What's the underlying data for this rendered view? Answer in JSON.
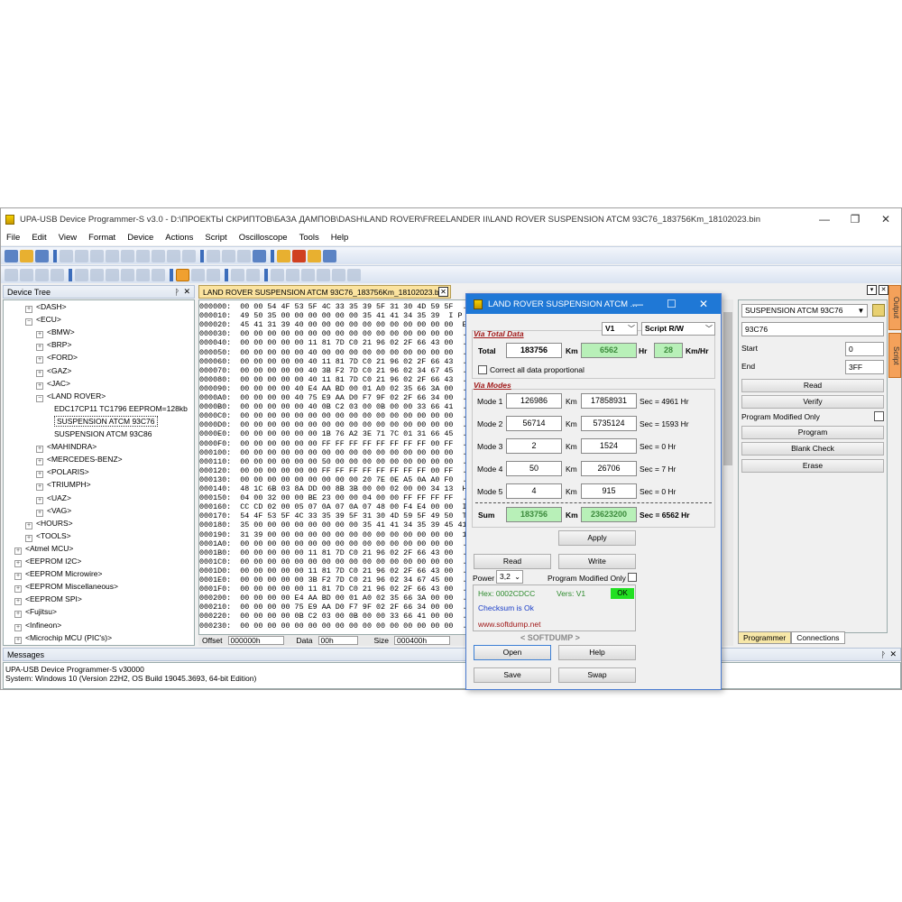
{
  "window": {
    "title": "UPA-USB Device Programmer-S v3.0 - D:\\ПРОЕКТЫ СКРИПТОВ\\БАЗА ДАМПОВ\\DASH\\LAND ROVER\\FREELANDER II\\LAND ROVER SUSPENSION ATCM 93C76_183756Km_18102023.bin",
    "minimize": "—",
    "maximize": "❐",
    "close": "✕"
  },
  "menu": [
    "File",
    "Edit",
    "View",
    "Format",
    "Device",
    "Actions",
    "Script",
    "Oscilloscope",
    "Tools",
    "Help"
  ],
  "device_tree": {
    "title": "Device Tree",
    "pin": "ᚹ",
    "close": "✕",
    "nodes": [
      {
        "label": "<DASH>",
        "pm": "+"
      },
      {
        "label": "<ECU>",
        "pm": "−"
      },
      {
        "label": "<BMW>",
        "pm": "+"
      },
      {
        "label": "<BRP>",
        "pm": "+"
      },
      {
        "label": "<FORD>",
        "pm": "+"
      },
      {
        "label": "<GAZ>",
        "pm": "+"
      },
      {
        "label": "<JAC>",
        "pm": "+"
      },
      {
        "label": "<LAND ROVER>",
        "pm": "−"
      },
      {
        "label": "EDC17CP11 TC1796 EEPROM=128kb",
        "pm": ""
      },
      {
        "label": "SUSPENSION ATCM 93C76",
        "pm": ""
      },
      {
        "label": "SUSPENSION ATCM 93C86",
        "pm": ""
      },
      {
        "label": "<MAHINDRA>",
        "pm": "+"
      },
      {
        "label": "<MERCEDES-BENZ>",
        "pm": "+"
      },
      {
        "label": "<POLARIS>",
        "pm": "+"
      },
      {
        "label": "<TRIUMPH>",
        "pm": "+"
      },
      {
        "label": "<UAZ>",
        "pm": "+"
      },
      {
        "label": "<VAG>",
        "pm": "+"
      },
      {
        "label": "<HOURS>",
        "pm": "+"
      },
      {
        "label": "<TOOLS>",
        "pm": "+"
      },
      {
        "label": "<Atmel MCU>",
        "pm": "+"
      },
      {
        "label": "<EEPROM I2C>",
        "pm": "+"
      },
      {
        "label": "<EEPROM Microwire>",
        "pm": "+"
      },
      {
        "label": "<EEPROM Miscellaneous>",
        "pm": "+"
      },
      {
        "label": "<EEPROM SPI>",
        "pm": "+"
      },
      {
        "label": "<Fujitsu>",
        "pm": "+"
      },
      {
        "label": "<Infineon>",
        "pm": "+"
      },
      {
        "label": "<Microchip MCU (PIC's)>",
        "pm": "+"
      }
    ]
  },
  "doc_tab": {
    "label": "LAND ROVER SUSPENSION ATCM 93C76_183756Km_18102023.bin",
    "close": "✕"
  },
  "hex_rows": [
    "000000:  00 00 54 4F 53 5F 4C 33 35 39 5F 31 30 4D 59 5F  . . T O",
    "000010:  49 50 35 00 00 00 00 00 00 35 41 41 34 35 39  I P 5 .",
    "000020:  45 41 31 39 40 00 00 00 00 00 00 00 00 00 00 00  E A 1 9",
    "000030:  00 00 00 00 00 00 00 00 00 00 00 00 00 00 00 00  . . . .",
    "000040:  00 00 00 00 00 11 81 7D C0 21 96 02 2F 66 43 00  . . . .",
    "000050:  00 00 00 00 00 40 00 00 00 00 00 00 00 00 00 00  . . . .",
    "000060:  00 00 00 00 00 40 11 81 7D C0 21 96 02 2F 66 43  . . . .",
    "000070:  00 00 00 00 00 40 3B F2 7D C0 21 96 02 34 67 45  . . . .",
    "000080:  00 00 00 00 00 40 11 81 7D C0 21 96 02 2F 66 43  . . . .",
    "000090:  00 00 00 00 40 E4 AA BD 00 01 A0 02 35 66 3A 00  . . . .",
    "0000A0:  00 00 00 00 40 75 E9 AA D0 F7 9F 02 2F 66 34 00  . . . .",
    "0000B0:  00 00 00 00 00 40 0B C2 03 00 0B 00 00 33 66 41  . . . .",
    "0000C0:  00 00 00 00 00 00 00 00 00 00 00 00 00 00 00 00  . . . .",
    "0000D0:  00 00 00 00 00 00 00 00 00 00 00 00 00 00 00 00  . . . .",
    "0000E0:  00 00 00 00 00 00 1B 76 A2 3E 71 7C 01 31 66 45  . . . .",
    "0000F0:  00 00 00 00 00 00 FF FF FF FF FF FF FF FF 00 FF  . . . .",
    "000100:  00 00 00 00 00 00 00 00 00 00 00 00 00 00 00 00  . . . .",
    "000110:  00 00 00 00 00 00 50 00 00 00 00 00 00 00 00 00  . . . .",
    "000120:  00 00 00 00 00 00 FF FF FF FF FF FF FF FF 00 FF  . . . .",
    "000130:  00 00 00 00 00 00 00 00 00 20 7E 0E A5 0A A0 F0  . . . .",
    "000140:  48 1C 6B 03 8A DD 00 8B 3B 00 00 02 00 00 34 13  H . k .",
    "000150:  04 00 32 00 00 BE 23 00 00 04 00 00 FF FF FF FF  . . 2 .",
    "000160:  CC CD 02 00 05 07 0A 07 0A 07 48 00 F4 E4 00 00  I I . .",
    "000170:  54 4F 53 5F 4C 33 35 39 5F 31 30 4D 59 5F 49 50  T O S _",
    "000180:  35 00 00 00 00 00 00 00 00 35 41 41 34 35 39 45 41  5 . . .",
    "000190:  31 39 00 00 00 00 00 00 00 00 00 00 00 00 00 00  1 9 . .",
    "0001A0:  00 00 00 00 00 00 00 00 00 00 00 00 00 00 00 00  . . . .",
    "0001B0:  00 00 00 00 00 11 81 7D C0 21 96 02 2F 66 43 00  . . . .",
    "0001C0:  00 00 00 00 00 00 00 00 00 00 00 00 00 00 00 00  . . . .",
    "0001D0:  00 00 00 00 00 11 81 7D C0 21 96 02 2F 66 43 00  . . . .",
    "0001E0:  00 00 00 00 00 3B F2 7D C0 21 96 02 34 67 45 00  . . . .",
    "0001F0:  00 00 00 00 00 11 81 7D C0 21 96 02 2F 66 43 00  . . . .",
    "000200:  00 00 00 00 E4 AA BD 00 01 A0 02 35 66 3A 00 00  . . . .",
    "000210:  00 00 00 00 75 E9 AA D0 F7 9F 02 2F 66 34 00 00  . . . .",
    "000220:  00 00 00 00 0B C2 03 00 0B 00 00 33 66 41 00 00  . . . .",
    "000230:  00 00 00 00 00 00 00 00 00 00 00 00 00 00 00 00  . . . ."
  ],
  "hex_footer": {
    "offset_label": "Offset",
    "offset": "000000h",
    "data_label": "Data",
    "data": "00h",
    "size_label": "Size",
    "size": "000400h"
  },
  "right_panel": {
    "device": "SUSPENSION ATCM 93C76",
    "device_field": "93C76",
    "start_label": "Start",
    "start": "0",
    "end_label": "End",
    "end": "3FF",
    "read": "Read",
    "verify": "Verify",
    "program_modified_only": "Program Modified Only",
    "program": "Program",
    "blank_check": "Blank Check",
    "erase": "Erase",
    "tab_programmer": "Programmer",
    "tab_connections": "Connections",
    "side_output": "Output",
    "side_script": "Script"
  },
  "messages": {
    "title": "Messages",
    "lines": [
      "UPA-USB Device Programmer-S v30000",
      "System: Windows 10 (Version 22H2, OS Build 19045.3693, 64-bit Edition)"
    ]
  },
  "dialog": {
    "title": "LAND ROVER SUSPENSION ATCM ...",
    "min": "—",
    "max": "☐",
    "close": "✕",
    "via_total_data": "Via Total Data",
    "version": "V1",
    "script_mode": "Script R/W",
    "total_label": "Total",
    "total_km": "183756",
    "km": "Km",
    "total_hr": "6562",
    "hr": "Hr",
    "speed": "28",
    "kmhr": "Km/Hr",
    "correct_all": "Correct all data proportional",
    "via_modes": "Via Modes",
    "modes": [
      {
        "label": "Mode 1",
        "km": "126986",
        "sec": "17858931",
        "hr": "Sec = 4961 Hr"
      },
      {
        "label": "Mode 2",
        "km": "56714",
        "sec": "5735124",
        "hr": "Sec = 1593 Hr"
      },
      {
        "label": "Mode 3",
        "km": "2",
        "sec": "1524",
        "hr": "Sec = 0 Hr"
      },
      {
        "label": "Mode 4",
        "km": "50",
        "sec": "26706",
        "hr": "Sec = 7 Hr"
      },
      {
        "label": "Mode 5",
        "km": "4",
        "sec": "915",
        "hr": "Sec = 0 Hr"
      }
    ],
    "sum_label": "Sum",
    "sum_km": "183756",
    "sum_sec": "23623200",
    "sum_hr": "Sec = 6562 Hr",
    "apply": "Apply",
    "read": "Read",
    "write": "Write",
    "power_label": "Power",
    "power": "3,2",
    "program_modified_only": "Program Modified Only",
    "hex": "Hex: 0002CDCC",
    "vers": "Vers: V1",
    "ok": "OK",
    "checksum": "Checksum is Ok",
    "site": "www.softdump.net",
    "brand": "< SOFTDUMP >",
    "open": "Open",
    "help": "Help",
    "save": "Save",
    "swap": "Swap"
  }
}
